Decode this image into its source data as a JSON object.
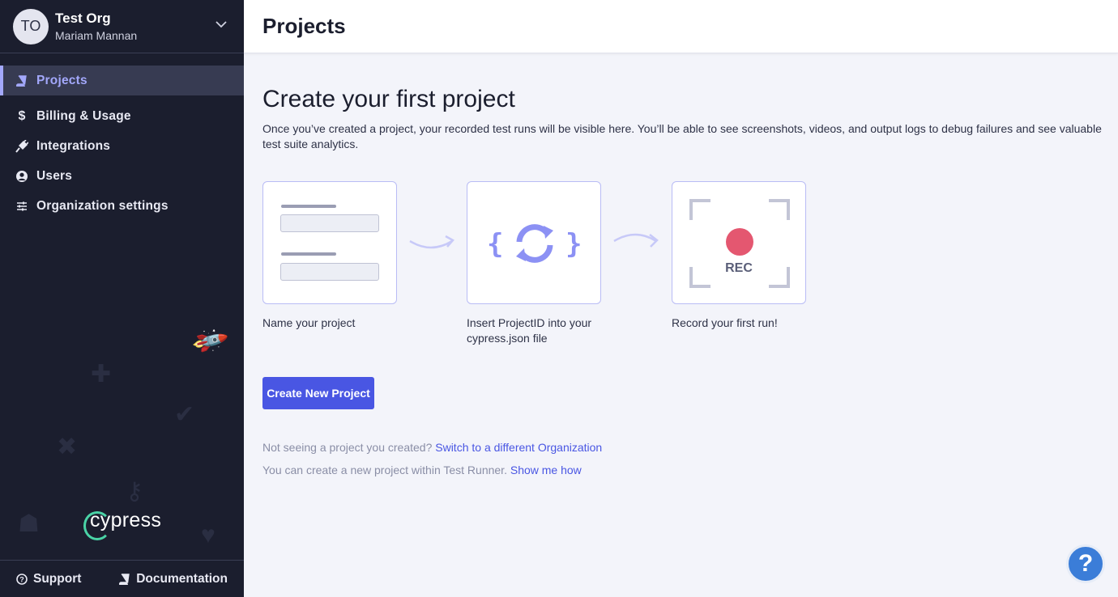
{
  "org": {
    "initials": "TO",
    "name": "Test Org",
    "user": "Mariam Mannan"
  },
  "sidebar": {
    "items": [
      {
        "label": "Projects",
        "icon": "book-icon"
      },
      {
        "label": "Billing & Usage",
        "icon": "dollar-icon"
      },
      {
        "label": "Integrations",
        "icon": "plug-icon"
      },
      {
        "label": "Users",
        "icon": "user-circle-icon"
      },
      {
        "label": "Organization settings",
        "icon": "sliders-icon"
      }
    ],
    "logo_text": "cypress",
    "footer": {
      "support": "Support",
      "documentation": "Documentation"
    }
  },
  "header": {
    "title": "Projects"
  },
  "main": {
    "headline": "Create your first project",
    "lead": "Once you’ve created a project, your recorded test runs will be visible here. You’ll be able to see screenshots, videos, and output logs to debug failures and see valuable test suite analytics.",
    "steps": [
      {
        "label": "Name your project"
      },
      {
        "label": "Insert ProjectID into your cypress.json file"
      },
      {
        "label": "Record your first run!",
        "badge": "REC"
      }
    ],
    "create_button": "Create New Project",
    "hints": [
      {
        "text": "Not seeing a project you created?",
        "link": "Switch to a different Organization"
      },
      {
        "text": "You can create a new project within Test Runner.",
        "link": "Show me how"
      }
    ]
  },
  "help_button": "?",
  "colors": {
    "accent": "#4956e3",
    "sidebar": "#1b1e2e",
    "active": "#a3a8fb",
    "rec": "#e45770",
    "cypress_green": "#4ad3a6"
  }
}
